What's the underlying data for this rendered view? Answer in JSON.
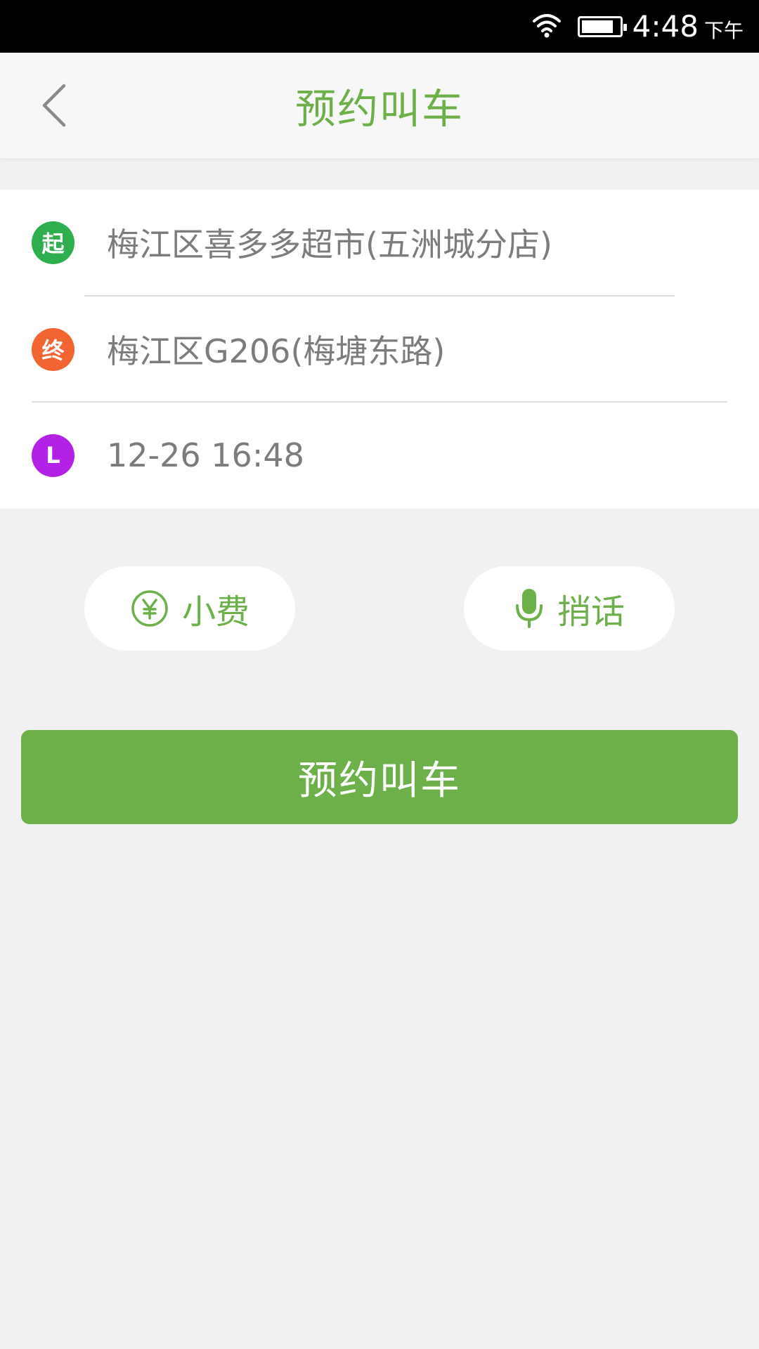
{
  "status_bar": {
    "time": "4:48",
    "ampm": "下午"
  },
  "header": {
    "title": "预约叫车"
  },
  "form": {
    "start": {
      "badge": "起",
      "address": "梅江区喜多多超市(五洲城分店)",
      "color": "#2fae4f"
    },
    "end": {
      "badge": "终",
      "address": "梅江区G206(梅塘东路)",
      "color": "#f26533"
    },
    "time": {
      "badge": "L",
      "value": "12-26  16:48",
      "color": "#b421e6"
    }
  },
  "actions": {
    "tip_label": "小费",
    "message_label": "捎话"
  },
  "submit": {
    "label": "预约叫车"
  },
  "colors": {
    "accent": "#6db04a",
    "background": "#f1f1f1"
  }
}
